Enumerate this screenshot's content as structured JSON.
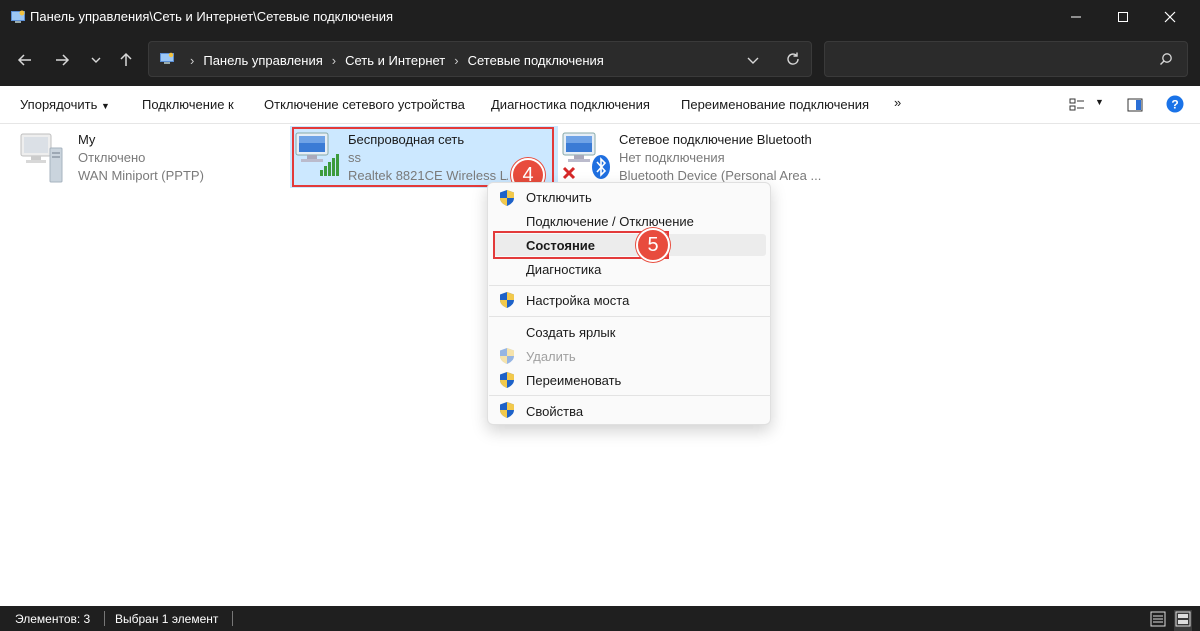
{
  "window": {
    "title": "Панель управления\\Сеть и Интернет\\Сетевые подключения",
    "icon": "control-panel-icon"
  },
  "address": {
    "crumbs": [
      "Панель управления",
      "Сеть и Интернет",
      "Сетевые подключения"
    ],
    "search_placeholder": ""
  },
  "toolbar": {
    "organize": "Упорядочить",
    "connect_to": "Подключение к",
    "disable_device": "Отключение сетевого устройства",
    "diagnose": "Диагностика подключения",
    "rename": "Переименование подключения",
    "more": "»"
  },
  "items": [
    {
      "name": "My",
      "status": "Отключено",
      "device": "WAN Miniport (PPTP)"
    },
    {
      "name": "Беспроводная сеть",
      "status": "ss",
      "device": "Realtek 8821CE Wireless LAN"
    },
    {
      "name": "Сетевое подключение Bluetooth",
      "status": "Нет подключения",
      "device": "Bluetooth Device (Personal Area ..."
    }
  ],
  "annotations": {
    "step4": "4",
    "step5": "5"
  },
  "context_menu": {
    "items": [
      {
        "label": "Отключить",
        "shield": true
      },
      {
        "label": "Подключение / Отключение",
        "shield": false
      },
      {
        "label": "Состояние",
        "shield": false,
        "bold": true
      },
      {
        "label": "Диагностика",
        "shield": false
      },
      {
        "label": "Настройка моста",
        "shield": true
      },
      {
        "label": "Создать ярлык",
        "shield": false
      },
      {
        "label": "Удалить",
        "shield": true,
        "disabled": true
      },
      {
        "label": "Переименовать",
        "shield": true
      },
      {
        "label": "Свойства",
        "shield": true
      }
    ]
  },
  "status": {
    "count": "Элементов: 3",
    "selected": "Выбран 1 элемент"
  },
  "colors": {
    "accent_red": "#e84c3d",
    "selection": "#cce8ff",
    "dark_chrome": "#1f1f1f",
    "help_blue": "#1a73e8"
  }
}
